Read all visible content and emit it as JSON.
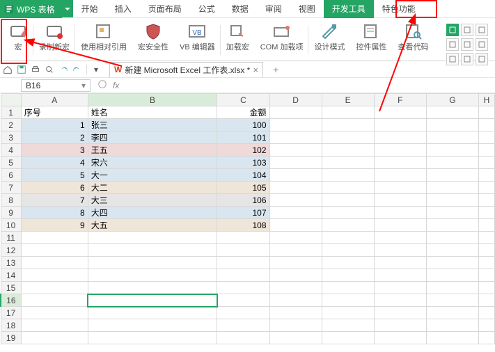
{
  "app": {
    "name": "WPS 表格"
  },
  "menu": {
    "items": [
      "开始",
      "插入",
      "页面布局",
      "公式",
      "数据",
      "审阅",
      "视图",
      "开发工具",
      "特色功能"
    ],
    "active_index": 7
  },
  "ribbon": {
    "groups": [
      {
        "key": "macro",
        "label": "宏",
        "icon": "macro-icon"
      },
      {
        "key": "record-macro",
        "label": "录制新宏",
        "icon": "record-macro-icon"
      },
      {
        "key": "relative-ref",
        "label": "使用相对引用",
        "icon": "relative-ref-icon"
      },
      {
        "key": "macro-security",
        "label": "宏安全性",
        "icon": "shield-icon"
      },
      {
        "key": "vb-editor",
        "label": "VB 编辑器",
        "icon": "vb-editor-icon"
      },
      {
        "key": "addins",
        "label": "加载宏",
        "icon": "addins-icon"
      },
      {
        "key": "com-addins",
        "label": "COM 加载项",
        "icon": "com-addin-icon"
      },
      {
        "key": "design-mode",
        "label": "设计模式",
        "icon": "design-mode-icon"
      },
      {
        "key": "ctrl-props",
        "label": "控件属性",
        "icon": "properties-icon"
      },
      {
        "key": "view-code",
        "label": "查看代码",
        "icon": "view-code-icon"
      }
    ]
  },
  "file_tab": {
    "name": "新建 Microsoft Excel 工作表.xlsx *"
  },
  "namebox": {
    "value": "B16"
  },
  "columns": [
    "A",
    "B",
    "C",
    "D",
    "E",
    "F",
    "G",
    "H"
  ],
  "row_count": 19,
  "active_cell": {
    "row": 16,
    "col": "B"
  },
  "headers": {
    "A": "序号",
    "B": "姓名",
    "C": "金额"
  },
  "data_rows": [
    {
      "n": 1,
      "name": "张三",
      "amt": 100,
      "style": "blue"
    },
    {
      "n": 2,
      "name": "李四",
      "amt": 101,
      "style": "blue"
    },
    {
      "n": 3,
      "name": "王五",
      "amt": 102,
      "style": "red"
    },
    {
      "n": 4,
      "name": "宋六",
      "amt": 103,
      "style": "blue"
    },
    {
      "n": 5,
      "name": "大一",
      "amt": 104,
      "style": "blue"
    },
    {
      "n": 6,
      "name": "大二",
      "amt": 105,
      "style": "tan"
    },
    {
      "n": 7,
      "name": "大三",
      "amt": 106,
      "style": "gray"
    },
    {
      "n": 8,
      "name": "大四",
      "amt": 107,
      "style": "blue"
    },
    {
      "n": 9,
      "name": "大五",
      "amt": 108,
      "style": "tan"
    }
  ],
  "highlights": [
    {
      "name": "macro-button-highlight"
    },
    {
      "name": "dev-tools-tab-highlight"
    }
  ]
}
